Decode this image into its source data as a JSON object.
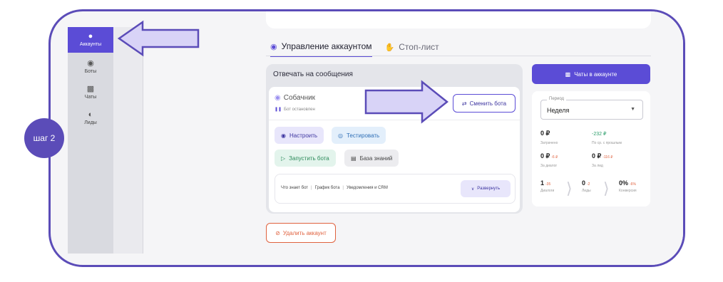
{
  "sidebar": {
    "items": [
      {
        "label": "Аккаунты",
        "icon": "user-icon",
        "active": true
      },
      {
        "label": "Боты",
        "icon": "bot-icon"
      },
      {
        "label": "Чаты",
        "icon": "chat-icon"
      },
      {
        "label": "Лиды",
        "icon": "leads-icon"
      }
    ]
  },
  "tabs": [
    {
      "label": "Управление аккаунтом",
      "active": true
    },
    {
      "label": "Стоп-лист",
      "active": false
    }
  ],
  "reply_card": {
    "title": "Отвечать на сообщения",
    "bot_name": "Собачник",
    "bot_status": "Бот остановлен",
    "swap_button": "Сменить бота",
    "actions": {
      "setup": "Настроить",
      "test": "Тестировать",
      "run": "Запустить бота",
      "knowledge": "База знаний"
    },
    "expander": {
      "items": [
        "Что знает бот",
        "График бота",
        "Уведомления и CRM"
      ],
      "button": "Развернуть"
    }
  },
  "delete_button": "Удалить аккаунт",
  "chats_button": "Чаты в аккаунте",
  "stats": {
    "period_label": "Период",
    "period_value": "Неделя",
    "spent": {
      "value": "0 ₽",
      "label": "Затрачено"
    },
    "compare": {
      "value": "-232 ₽",
      "label": "По ср. с прошлым"
    },
    "per_dialog": {
      "value": "0 ₽",
      "delta": "-6 ₽",
      "label": "За диалог"
    },
    "per_lead": {
      "value": "0 ₽",
      "delta": "-116 ₽",
      "label": "За лид"
    },
    "funnel": [
      {
        "value": "1",
        "delta": "-35",
        "label": "Диалоги"
      },
      {
        "value": "0",
        "delta": "-2",
        "label": "Лиды"
      },
      {
        "value": "0%",
        "delta": "-6%",
        "label": "Конверсия"
      }
    ]
  },
  "step_badge": "шаг 2",
  "colors": {
    "accent": "#5b4cd6",
    "frame": "#5b4cb8",
    "danger": "#e0623f",
    "arrow_fill": "#d8d3f7"
  }
}
